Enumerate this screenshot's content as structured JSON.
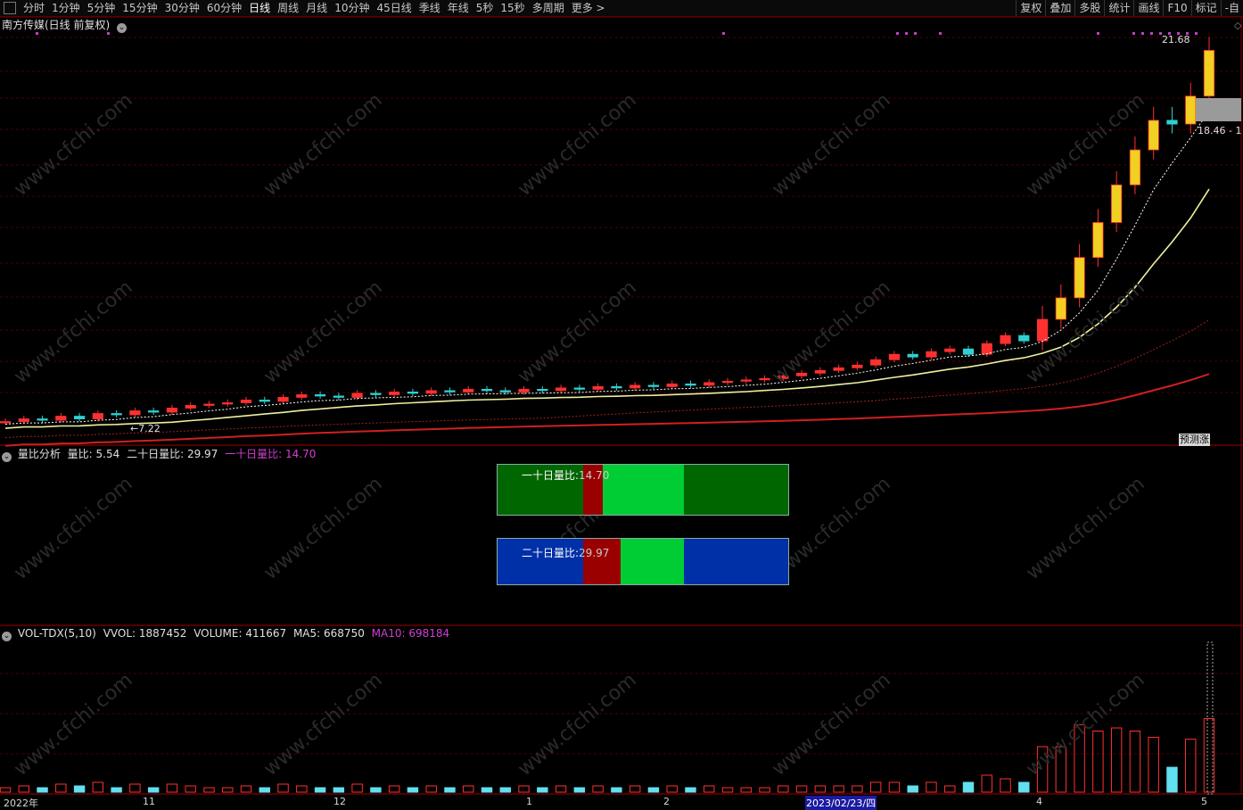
{
  "toolbar": {
    "periods": [
      "分时",
      "1分钟",
      "5分钟",
      "15分钟",
      "30分钟",
      "60分钟",
      "日线",
      "周线",
      "月线",
      "10分钟",
      "45日线",
      "季线",
      "年线",
      "5秒",
      "15秒",
      "多周期",
      "更多 >"
    ],
    "active_period": "日线",
    "right_buttons": [
      "复权",
      "叠加",
      "多股",
      "统计",
      "画线",
      "F10",
      "标记",
      "-自"
    ]
  },
  "main_panel": {
    "title": "南方传媒(日线 前复权)",
    "high_label": "21.68",
    "low_label": "←7.22",
    "price_tag": "18.46 - 1",
    "note_tag": "预测涨"
  },
  "ratio_panel": {
    "title": "量比分析",
    "volume_ratio_label": "量比:",
    "volume_ratio": "5.54",
    "ratio20_label": "二十日量比:",
    "ratio20": "29.97",
    "ratio10_label": "一十日量比:",
    "ratio10": "14.70",
    "gauge1_label": "一十日量比:",
    "gauge1_value": "14.70",
    "gauge2_label": "二十日量比:",
    "gauge2_value": "29.97",
    "colors": {
      "ratio10": "#d040d0",
      "gauge_green": "#006600",
      "gauge_blue": "#0030a8",
      "segment_bright": "#00cc33",
      "segment_red": "#9b0000"
    }
  },
  "vol_panel": {
    "name": "VOL-TDX(5,10)",
    "vvol_label": "VVOL:",
    "vvol": "1887452",
    "volume_label": "VOLUME:",
    "volume": "411667",
    "ma5_label": "MA5:",
    "ma5": "668750",
    "ma10_label": "MA10:",
    "ma10": "698184"
  },
  "x_axis": {
    "labels": [
      "2022年",
      "11",
      "12",
      "1",
      "2",
      "2023/02/23/四",
      "4",
      "5"
    ]
  },
  "watermark": "www.cfchi.com",
  "chart_data": {
    "type": "candlestick",
    "title": "南方传媒(日线 前复权)",
    "period": "daily",
    "price_high": 21.68,
    "price_low": 7.22,
    "last_price_tag": 18.46,
    "x_tick_labels": [
      "2022年",
      "11",
      "12",
      "1",
      "2",
      "2023/02/23/四",
      "4",
      "5"
    ],
    "indicators": {
      "volume_ratio": 5.54,
      "twenty_day_volume_ratio": 29.97,
      "ten_day_volume_ratio": 14.7,
      "vvol": 1887452,
      "volume": 411667,
      "vol_ma5": 668750,
      "vol_ma10": 698184
    },
    "closes_approx": [
      7.4,
      7.5,
      7.45,
      7.6,
      7.5,
      7.7,
      7.65,
      7.8,
      7.75,
      7.9,
      8.0,
      8.05,
      8.1,
      8.2,
      8.15,
      8.3,
      8.4,
      8.35,
      8.3,
      8.45,
      8.4,
      8.5,
      8.45,
      8.55,
      8.5,
      8.6,
      8.55,
      8.5,
      8.6,
      8.55,
      8.65,
      8.6,
      8.7,
      8.65,
      8.75,
      8.7,
      8.8,
      8.75,
      8.85,
      8.9,
      8.95,
      9.0,
      9.1,
      9.2,
      9.3,
      9.4,
      9.5,
      9.7,
      9.9,
      9.8,
      10.0,
      10.1,
      9.9,
      10.3,
      10.6,
      10.4,
      11.2,
      12.0,
      13.5,
      14.8,
      16.2,
      17.5,
      18.6,
      18.46,
      19.5,
      21.2
    ]
  }
}
